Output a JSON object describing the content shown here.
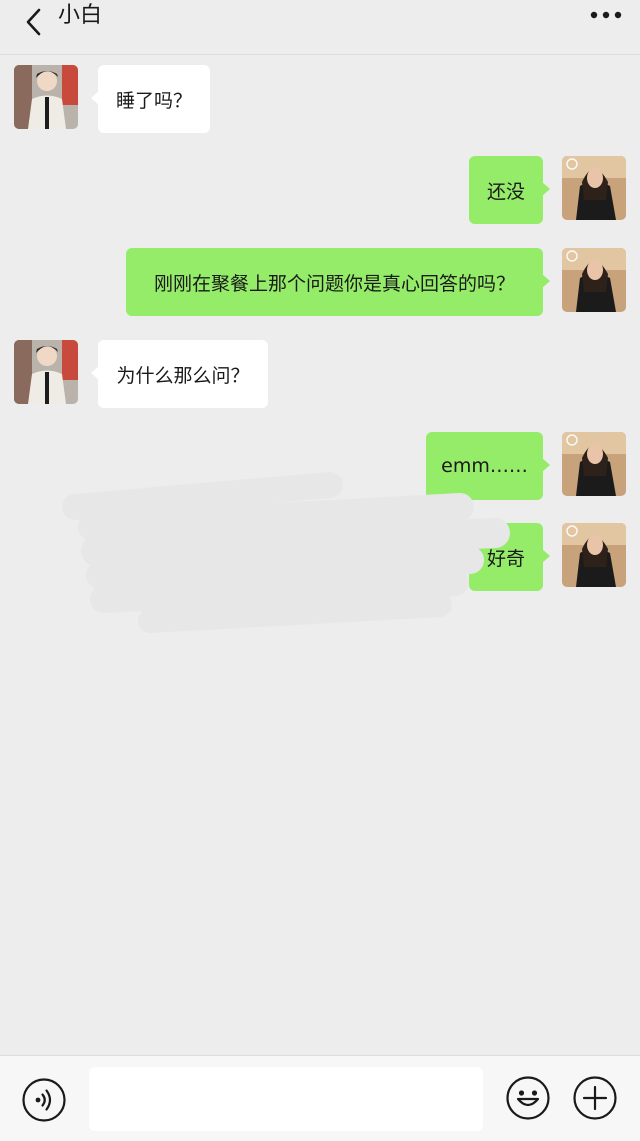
{
  "header": {
    "title": "小白",
    "back_icon": "chevron-left-icon",
    "more_icon": "more-horizontal-icon"
  },
  "messages": [
    {
      "side": "left",
      "text": "睡了吗？"
    },
    {
      "side": "right",
      "text": "还没"
    },
    {
      "side": "right",
      "text": "刚刚在聚餐上那个问题你是真心回答的吗？"
    },
    {
      "side": "left",
      "text": "为什么那么问？"
    },
    {
      "side": "right",
      "text": "emm……"
    },
    {
      "side": "right",
      "text": "好奇"
    }
  ],
  "input_bar": {
    "voice_icon": "voice-icon",
    "input_value": "",
    "emoji_icon": "emoji-icon",
    "plus_icon": "plus-icon"
  },
  "colors": {
    "background": "#ededed",
    "sent_bubble": "#95ec69",
    "received_bubble": "#ffffff",
    "text": "#1a1a1a"
  }
}
